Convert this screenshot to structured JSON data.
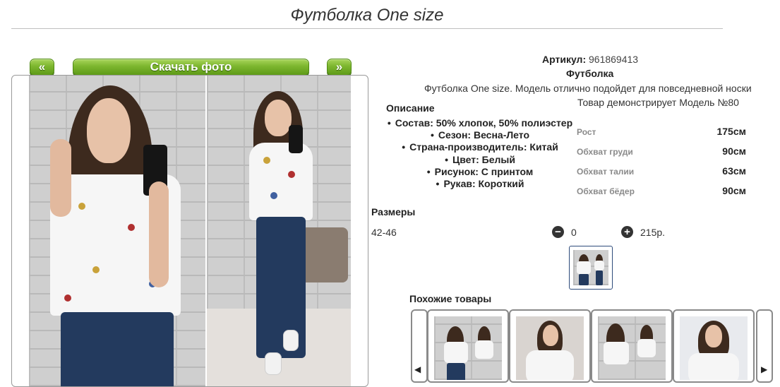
{
  "page": {
    "title": "Футболка One size"
  },
  "gallery": {
    "prev_label": "«",
    "download_label": "Скачать фото",
    "next_label": "»"
  },
  "product": {
    "article_label": "Артикул:",
    "article_value": "961869413",
    "name": "Футболка",
    "description": "Футболка One size. Модель отлично подойдет для повседневной носки",
    "model_note": "Товар демонстрирует Модель №80",
    "description_heading": "Описание",
    "features": [
      "Состав: 50% хлопок, 50% полиэстер",
      "Сезон: Весна-Лето",
      "Страна-производитель: Китай",
      "Цвет: Белый",
      "Рисунок: С принтом",
      "Рукав: Короткий"
    ]
  },
  "model_measurements": [
    {
      "label": "Рост",
      "value": "175см"
    },
    {
      "label": "Обхват груди",
      "value": "90см"
    },
    {
      "label": "Обхват талии",
      "value": "63см"
    },
    {
      "label": "Обхват бёдер",
      "value": "90см"
    }
  ],
  "sizes": {
    "heading": "Размеры",
    "range": "42-46",
    "quantity": "0",
    "price": "215р.",
    "minus_icon": "minus-circle-icon",
    "plus_icon": "plus-circle-icon"
  },
  "similar": {
    "heading": "Похожие товары",
    "prev_icon": "skip-back-icon",
    "next_icon": "skip-forward-icon"
  },
  "colors": {
    "button_green": "#7cb62e",
    "text_dark": "#222222",
    "label_gray": "#8a8a8a",
    "thumb_border": "#2d4a7a"
  }
}
